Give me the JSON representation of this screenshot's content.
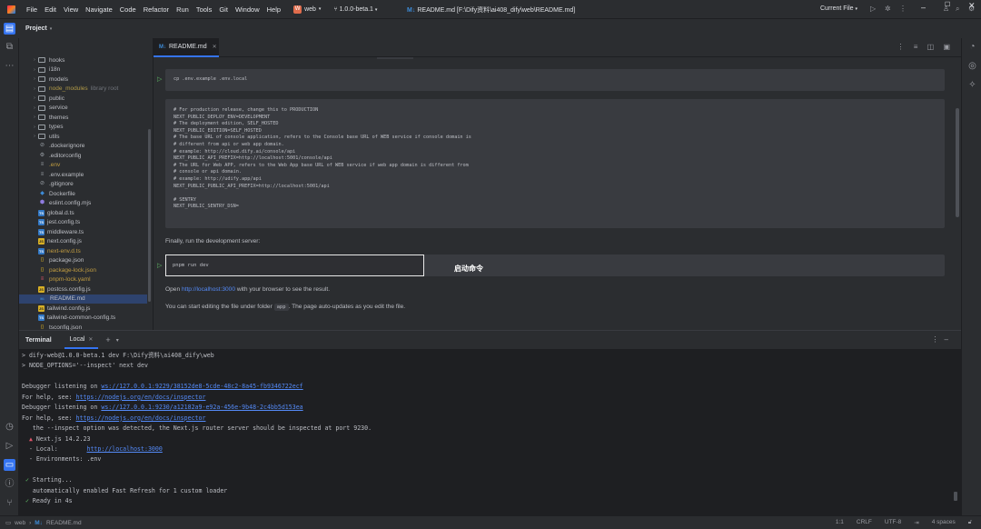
{
  "titlebar": {
    "menu": [
      "File",
      "Edit",
      "View",
      "Navigate",
      "Code",
      "Refactor",
      "Run",
      "Tools",
      "Git",
      "Window",
      "Help"
    ],
    "project_badge": "W",
    "project_name": "web",
    "branch": "1.0.0-beta.1",
    "window_title_prefix": "M↓",
    "window_title": "README.md [F:\\Dify资料\\ai408_dify\\web\\README.md]",
    "run_config": "Current File"
  },
  "project_panel": {
    "title": "Project",
    "items": [
      {
        "label": "hooks",
        "kind": "folder"
      },
      {
        "label": "i18n",
        "kind": "folder"
      },
      {
        "label": "models",
        "kind": "folder"
      },
      {
        "label": "node_modules",
        "kind": "folder",
        "style": "excluded",
        "extra": "library root"
      },
      {
        "label": "public",
        "kind": "folder"
      },
      {
        "label": "service",
        "kind": "folder"
      },
      {
        "label": "themes",
        "kind": "folder"
      },
      {
        "label": "types",
        "kind": "folder"
      },
      {
        "label": "utils",
        "kind": "folder"
      },
      {
        "label": ".dockerignore",
        "kind": "circle"
      },
      {
        "label": ".editorconfig",
        "kind": "gear"
      },
      {
        "label": ".env",
        "kind": "lines",
        "style": "ignored"
      },
      {
        "label": ".env.example",
        "kind": "lines"
      },
      {
        "label": ".gitignore",
        "kind": "circle"
      },
      {
        "label": "Dockerfile",
        "kind": "docker"
      },
      {
        "label": "eslint.config.mjs",
        "kind": "eslint"
      },
      {
        "label": "global.d.ts",
        "kind": "ts"
      },
      {
        "label": "jest.config.ts",
        "kind": "ts"
      },
      {
        "label": "middleware.ts",
        "kind": "ts"
      },
      {
        "label": "next.config.js",
        "kind": "js"
      },
      {
        "label": "next-env.d.ts",
        "kind": "ts",
        "style": "ignored"
      },
      {
        "label": "package.json",
        "kind": "json"
      },
      {
        "label": "package-lock.json",
        "kind": "json",
        "style": "ignored"
      },
      {
        "label": "pnpm-lock.yaml",
        "kind": "yaml",
        "style": "ignored"
      },
      {
        "label": "postcss.config.js",
        "kind": "js"
      },
      {
        "label": "README.md",
        "kind": "md",
        "style": "selected"
      },
      {
        "label": "tailwind.config.js",
        "kind": "js"
      },
      {
        "label": "tailwind-common-config.ts",
        "kind": "ts"
      },
      {
        "label": "tsconfig.json",
        "kind": "json"
      }
    ]
  },
  "editor": {
    "tab_label": "README.md",
    "tab_prefix": "M↓",
    "code_env_copy": "cp .env.example .env.local",
    "env_block": [
      "# For production release, change this to PRODUCTION",
      "NEXT_PUBLIC_DEPLOY_ENV=DEVELOPMENT",
      "# The deployment edition, SELF_HOSTED",
      "NEXT_PUBLIC_EDITION=SELF_HOSTED",
      "# The base URL of console application, refers to the Console base URL of WEB service if console domain is",
      "# different from api or web app domain.",
      "# example: http://cloud.dify.ai/console/api",
      "NEXT_PUBLIC_API_PREFIX=http://localhost:5001/console/api",
      "# The URL for Web APP, refers to the Web App base URL of WEB service if web app domain is different from",
      "# console or api domain.",
      "# example: http://udify.app/api",
      "NEXT_PUBLIC_PUBLIC_API_PREFIX=http://localhost:5001/api",
      "",
      "# SENTRY",
      "NEXT_PUBLIC_SENTRY_DSN="
    ],
    "finally_text": "Finally, run the development server:",
    "run_cmd": "pnpm run dev",
    "annotation": "启动命令",
    "open_prefix": "Open ",
    "open_link": "http://localhost:3000",
    "open_suffix": " with your browser to see the result.",
    "edit_prefix": "You can start editing the file under folder ",
    "edit_code": "app",
    "edit_suffix": ". The page auto-updates as you edit the file."
  },
  "terminal": {
    "title": "Terminal",
    "tab_label": "Local",
    "lines": [
      {
        "text": "> dify-web@1.0.0-beta.1 dev F:\\Dify资料\\ai408_dify\\web"
      },
      {
        "text": "> NODE_OPTIONS='--inspect' next dev"
      },
      {
        "text": ""
      },
      {
        "text": "Debugger listening on ",
        "link": "ws://127.0.0.1:9229/38152de8-5cde-48c2-8a45-fb9346722ecf"
      },
      {
        "text": "For help, see: ",
        "link": "https://nodejs.org/en/docs/inspector"
      },
      {
        "text": "Debugger listening on ",
        "link": "ws://127.0.0.1:9230/a12182a9-e92a-456e-9b48-2c4bb5d153ea"
      },
      {
        "text": "For help, see: ",
        "link": "https://nodejs.org/en/docs/inspector"
      },
      {
        "text": "   the --inspect option was detected, the Next.js router server should be inspected at port 9230."
      },
      {
        "prefix": "  ▲ ",
        "text": "Next.js 14.2.23",
        "prefix_class": "red"
      },
      {
        "text": "  - Local:        ",
        "link": "http://localhost:3000"
      },
      {
        "text": "  - Environments: .env"
      },
      {
        "text": ""
      },
      {
        "prefix": " ✓ ",
        "text": "Starting...",
        "prefix_class": "green"
      },
      {
        "text": "   automatically enabled Fast Refresh for 1 custom loader"
      },
      {
        "prefix": " ✓ ",
        "text": "Ready in 4s",
        "prefix_class": "green"
      }
    ]
  },
  "statusbar": {
    "project": "web",
    "file_prefix": "M↓",
    "file": "README.md",
    "position": "1:1",
    "line_sep": "CRLF",
    "encoding": "UTF-8",
    "indent": "4 spaces"
  }
}
